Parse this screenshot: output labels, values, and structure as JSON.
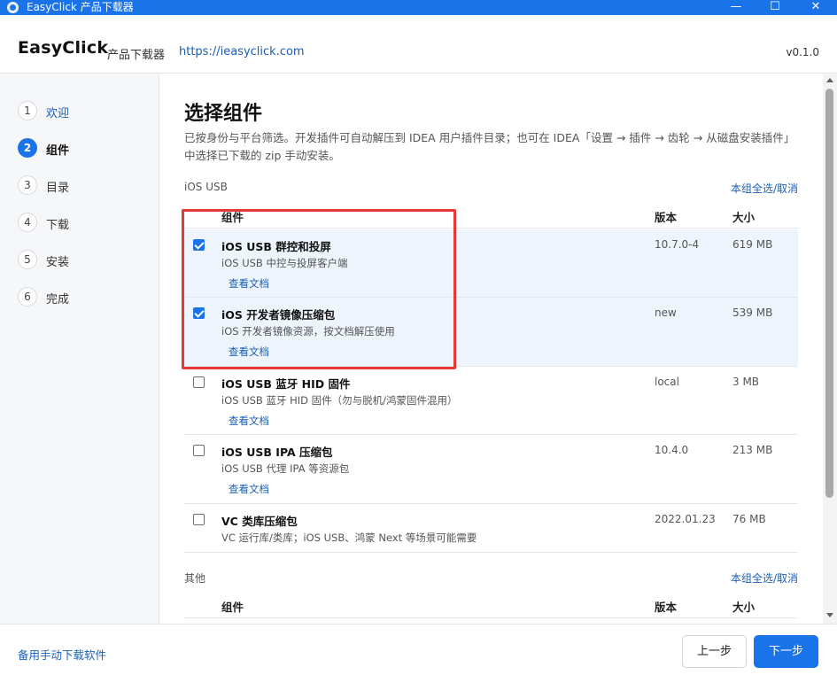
{
  "window": {
    "title": "EasyClick 产品下载器",
    "controls": {
      "minimize": "—",
      "maximize": "☐",
      "close": "✕"
    }
  },
  "header": {
    "brand": "EasyClick",
    "subtitle": "产品下载器",
    "link": "https://ieasyclick.com",
    "version": "v0.1.0"
  },
  "sidebar": {
    "steps": [
      {
        "num": "1",
        "label": "欢迎",
        "state": "done"
      },
      {
        "num": "2",
        "label": "组件",
        "state": "active"
      },
      {
        "num": "3",
        "label": "目录",
        "state": "pending"
      },
      {
        "num": "4",
        "label": "下载",
        "state": "pending"
      },
      {
        "num": "5",
        "label": "安装",
        "state": "pending"
      },
      {
        "num": "6",
        "label": "完成",
        "state": "pending"
      }
    ]
  },
  "main": {
    "title": "选择组件",
    "description": "已按身份与平台筛选。开发插件可自动解压到 IDEA 用户插件目录；也可在 IDEA「设置 → 插件 → 齿轮 → 从磁盘安装插件」中选择已下载的 zip 手动安装。",
    "columns": {
      "name": "组件",
      "version": "版本",
      "size": "大小"
    },
    "groups": [
      {
        "label": "iOS USB",
        "toggle": "本组全选/取消",
        "rows": [
          {
            "name": "iOS USB 群控和投屏",
            "desc": "iOS USB 中控与投屏客户端",
            "doc": "查看文档",
            "version": "10.7.0-4",
            "size": "619 MB",
            "checked": true
          },
          {
            "name": "iOS 开发者镜像压缩包",
            "desc": "iOS 开发者镜像资源，按文档解压使用",
            "doc": "查看文档",
            "version": "new",
            "size": "539 MB",
            "checked": true
          },
          {
            "name": "iOS USB 蓝牙 HID 固件",
            "desc": "iOS USB 蓝牙 HID 固件（勿与脱机/鸿蒙固件混用）",
            "doc": "查看文档",
            "version": "local",
            "size": "3 MB",
            "checked": false
          },
          {
            "name": "iOS USB IPA 压缩包",
            "desc": "iOS USB 代理 IPA 等资源包",
            "doc": "查看文档",
            "version": "10.4.0",
            "size": "213 MB",
            "checked": false
          },
          {
            "name": "VC 类库压缩包",
            "desc": "VC 运行库/类库；iOS USB、鸿蒙 Next 等场景可能需要",
            "doc": "",
            "version": "2022.01.23",
            "size": "76 MB",
            "checked": false
          }
        ]
      },
      {
        "label": "其他",
        "toggle": "本组全选/取消"
      }
    ]
  },
  "footer": {
    "manual_link": "备用手动下载软件",
    "prev": "上一步",
    "next": "下一步"
  },
  "colors": {
    "accent": "#1a73e8",
    "link": "#1a5fb4",
    "selected_row": "#edf4fb",
    "annotation_box": "#e53935"
  }
}
